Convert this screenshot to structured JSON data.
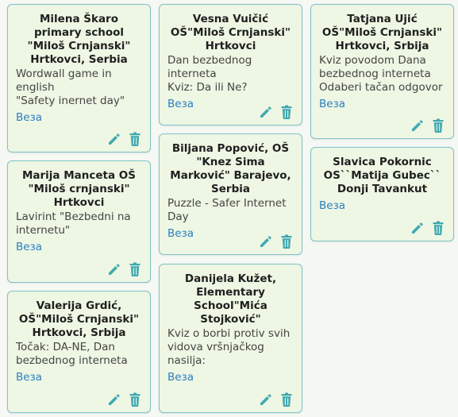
{
  "colors": {
    "accent": "#3fa9b0",
    "link": "#2a7fc0",
    "card_bg": "#eef6e4",
    "border": "#7ec3c7"
  },
  "cards": [
    {
      "title": "Milena Škaro primary school \"Miloš Crnjanski\" Hrtkovci, Serbia",
      "body": "Wordwall game in english\n\"Safety inernet day\"",
      "link": "Веза"
    },
    {
      "title": "Marija Manceta OŠ \"Miloš crnjanski\" Hrtkovci",
      "body": "Lavirint \"Bezbedni na internetu\"",
      "link": "Веза"
    },
    {
      "title": "Valerija Grdić, OŠ\"Miloš Crnjanski\" Hrtkovci, Srbija",
      "body": "Točak: DA-NE, Dan bezbednog interneta",
      "link": "Веза"
    },
    {
      "title": "Vesna Vuičić OŠ\"Miloš Crnjanski\" Hrtkovci",
      "body": "Dan bezbednog interneta\nKviz: Da ili Ne?",
      "link": "Веза"
    },
    {
      "title": "Biljana Popović, OŠ \"Knez Sima Marković\" Barajevo, Serbia",
      "body": "Puzzle - Safer Internet Day",
      "link": "Веза"
    },
    {
      "title": "Danijela Kužet, Elementary School\"Mića Stojković\"",
      "body": "Kviz o borbi protiv svih vidova vršnjačkog nasilja:",
      "link": "Веза"
    },
    {
      "title": "Tatjana Ujić OŠ\"Miloš Crnjanski\" Hrtkovci, Srbija",
      "body": "Kviz povodom Dana bezbednog interneta\nOdaberi tačan odgovor",
      "link": "Веза"
    },
    {
      "title": "Slavica Pokornic OS``Matija Gubec`` Donji Tavankut",
      "body": "",
      "link": "Веза"
    }
  ]
}
